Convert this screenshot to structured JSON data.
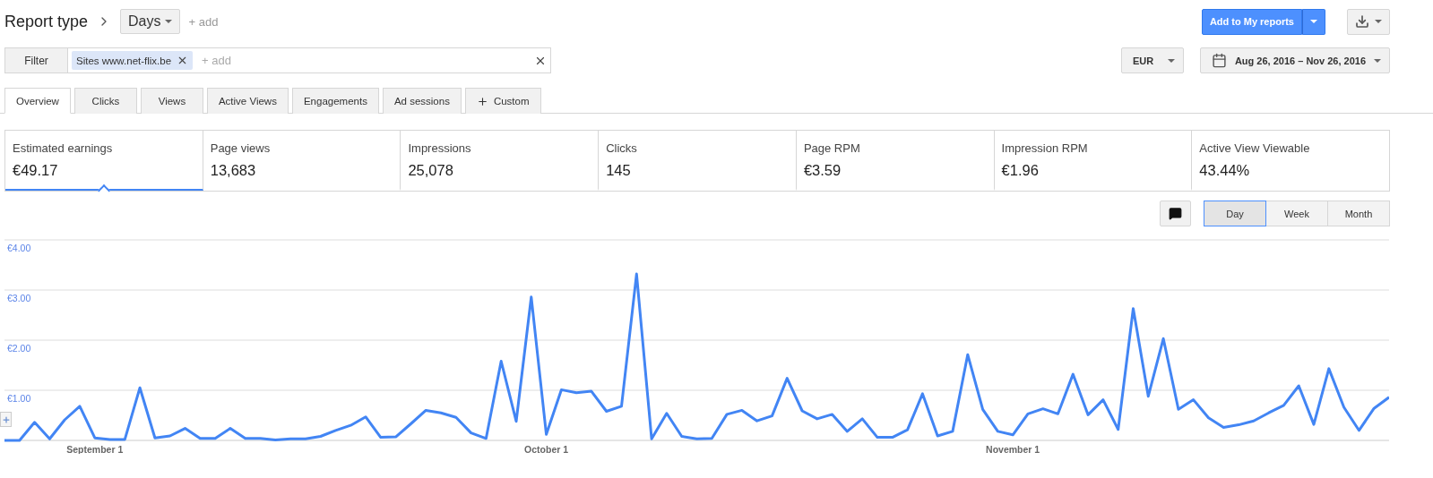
{
  "header": {
    "title": "Report type",
    "dimension": "Days",
    "add": "+ add",
    "primary_action": "Add to My reports"
  },
  "filter": {
    "button": "Filter",
    "chips": [
      {
        "label": "Sites www.net-flix.be"
      }
    ],
    "placeholder": "+ add"
  },
  "currency": "EUR",
  "date_range": "Aug 26, 2016 – Nov 26, 2016",
  "tabs": [
    {
      "label": "Overview",
      "selected": true,
      "kind": "tab"
    },
    {
      "label": "Clicks",
      "selected": false,
      "kind": "tab"
    },
    {
      "label": "Views",
      "selected": false,
      "kind": "tab"
    },
    {
      "label": "Active Views",
      "selected": false,
      "kind": "tab"
    },
    {
      "label": "Engagements",
      "selected": false,
      "kind": "tab"
    },
    {
      "label": "Ad sessions",
      "selected": false,
      "kind": "tab"
    },
    {
      "label": "Custom",
      "selected": false,
      "kind": "add"
    }
  ],
  "metrics": [
    {
      "label": "Estimated earnings",
      "value": "€49.17",
      "selected": true
    },
    {
      "label": "Page views",
      "value": "13,683",
      "selected": false
    },
    {
      "label": "Impressions",
      "value": "25,078",
      "selected": false
    },
    {
      "label": "Clicks",
      "value": "145",
      "selected": false
    },
    {
      "label": "Page RPM",
      "value": "€3.59",
      "selected": false
    },
    {
      "label": "Impression RPM",
      "value": "€1.96",
      "selected": false
    },
    {
      "label": "Active View Viewable",
      "value": "43.44%",
      "selected": false
    }
  ],
  "granularity": [
    {
      "label": "Day",
      "selected": true
    },
    {
      "label": "Week",
      "selected": false
    },
    {
      "label": "Month",
      "selected": false
    }
  ],
  "chart": {
    "chart_data": {
      "type": "line",
      "grid": true,
      "ylim": [
        0,
        4
      ],
      "yticks": [
        {
          "value": 1,
          "label": "€1.00"
        },
        {
          "value": 2,
          "label": "€2.00"
        },
        {
          "value": 3,
          "label": "€3.00"
        },
        {
          "value": 4,
          "label": "€4.00"
        }
      ],
      "categories": [
        null,
        null,
        null,
        null,
        null,
        null,
        "September 1",
        null,
        null,
        null,
        null,
        null,
        null,
        null,
        null,
        null,
        null,
        null,
        null,
        null,
        null,
        null,
        null,
        null,
        null,
        null,
        null,
        null,
        null,
        null,
        null,
        null,
        null,
        null,
        null,
        null,
        "October 1",
        null,
        null,
        null,
        null,
        null,
        null,
        null,
        null,
        null,
        null,
        null,
        null,
        null,
        null,
        null,
        null,
        null,
        null,
        null,
        null,
        null,
        null,
        null,
        null,
        null,
        null,
        null,
        null,
        null,
        null,
        "November 1",
        null,
        null,
        null,
        null,
        null,
        null,
        null,
        null,
        null,
        null,
        null,
        null,
        null,
        null,
        null,
        null,
        null,
        null,
        null,
        null,
        null,
        null,
        null,
        null,
        null
      ],
      "series": [
        {
          "color": "#4285f4",
          "values": [
            0,
            0,
            0.36,
            0.03,
            0.41,
            0.68,
            0.05,
            0.02,
            0.02,
            1.05,
            0.05,
            0.09,
            0.24,
            0.04,
            0.04,
            0.24,
            0.04,
            0.04,
            0.01,
            0.03,
            0.03,
            0.08,
            0.2,
            0.3,
            0.47,
            0.06,
            0.07,
            0.33,
            0.6,
            0.55,
            0.46,
            0.15,
            0.04,
            1.58,
            0.38,
            2.86,
            0.12,
            1.01,
            0.95,
            0.98,
            0.58,
            0.68,
            3.32,
            0.03,
            0.54,
            0.08,
            0.03,
            0.04,
            0.52,
            0.6,
            0.39,
            0.49,
            1.24,
            0.59,
            0.43,
            0.52,
            0.18,
            0.43,
            0.06,
            0.06,
            0.21,
            0.93,
            0.09,
            0.18,
            1.71,
            0.62,
            0.18,
            0.11,
            0.53,
            0.63,
            0.53,
            1.32,
            0.51,
            0.81,
            0.22,
            2.63,
            0.88,
            2.03,
            0.62,
            0.81,
            0.45,
            0.26,
            0.31,
            0.39,
            0.55,
            0.7,
            1.09,
            0.32,
            1.43,
            0.66,
            0.2,
            0.64,
            0.86
          ]
        }
      ]
    }
  }
}
